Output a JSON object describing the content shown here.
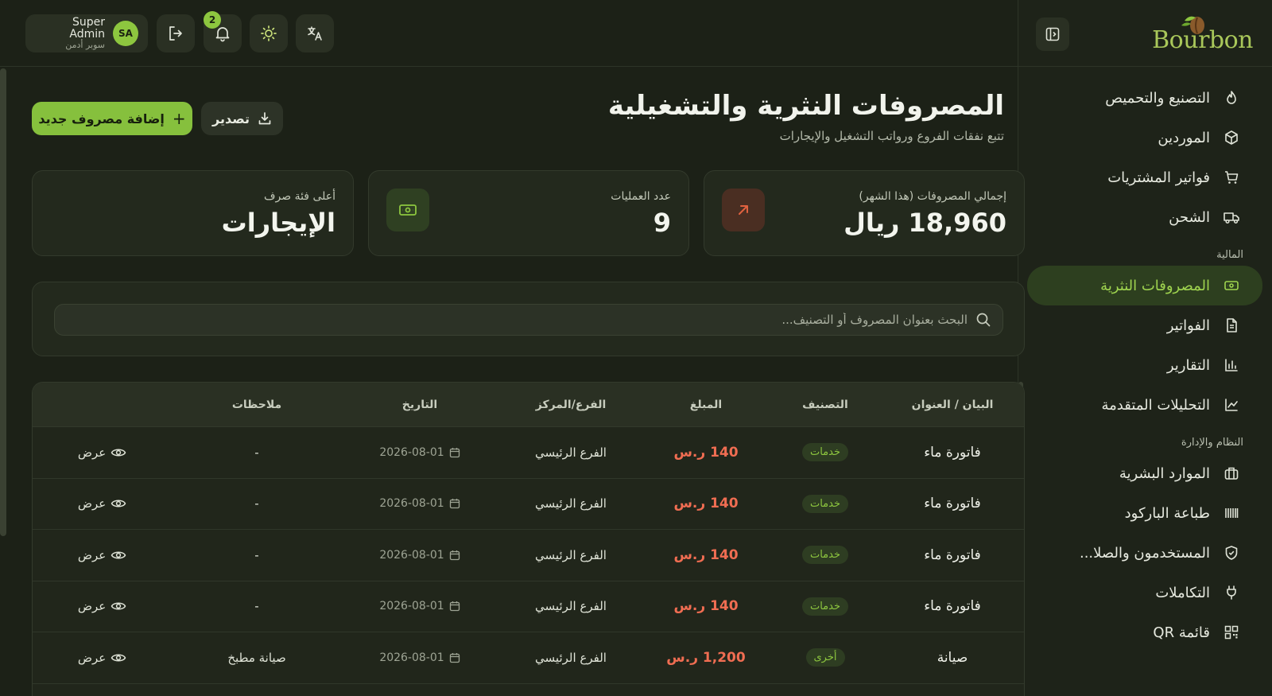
{
  "brand": {
    "name": "Bourbon",
    "accent": "#86c03d"
  },
  "topbar": {
    "user": {
      "name_en": "Super Admin",
      "name_ar": "سوبر أدمن",
      "initials": "SA"
    },
    "notifications_count": "2"
  },
  "sidebar": {
    "items_top": [
      {
        "label": "التصنيع والتحميص",
        "icon": "flame-icon"
      },
      {
        "label": "الموردين",
        "icon": "package-icon"
      },
      {
        "label": "فواتير المشتريات",
        "icon": "cart-icon"
      },
      {
        "label": "الشحن",
        "icon": "truck-icon"
      }
    ],
    "section_finance": "المالية",
    "items_finance": [
      {
        "label": "المصروفات النثرية",
        "icon": "banknote-icon",
        "active": true
      },
      {
        "label": "الفواتير",
        "icon": "file-icon"
      },
      {
        "label": "التقارير",
        "icon": "bar-chart-icon"
      },
      {
        "label": "التحليلات المتقدمة",
        "icon": "line-chart-icon"
      }
    ],
    "section_system": "النظام والإدارة",
    "items_system": [
      {
        "label": "الموارد البشرية",
        "icon": "briefcase-icon"
      },
      {
        "label": "طباعة الباركود",
        "icon": "barcode-icon"
      },
      {
        "label": "المستخدمون والصلا...",
        "icon": "shield-icon"
      },
      {
        "label": "التكاملات",
        "icon": "plug-icon"
      },
      {
        "label": "قائمة QR",
        "icon": "qr-icon"
      }
    ]
  },
  "page": {
    "title": "المصروفات النثرية والتشغيلية",
    "subtitle": "تتبع نفقات الفروع ورواتب التشغيل والإيجارات",
    "add_button": "إضافة مصروف جديد",
    "export_button": "تصدير"
  },
  "stats": [
    {
      "label": "إجمالي المصروفات (هذا الشهر)",
      "value": "18,960 ريال",
      "icon": "arrow-up-right-icon",
      "color": "#e0613f"
    },
    {
      "label": "عدد العمليات",
      "value": "9",
      "icon": "banknote-icon",
      "color": "#8dc63f"
    },
    {
      "label": "أعلى فئة صرف",
      "value": "الإيجارات"
    }
  ],
  "search": {
    "placeholder": "البحث بعنوان المصروف أو التصنيف..."
  },
  "table": {
    "headers": [
      "البيان / العنوان",
      "التصنيف",
      "المبلغ",
      "الفرع/المركز",
      "التاريخ",
      "ملاحظات"
    ],
    "view_label": "عرض",
    "rows": [
      {
        "title": "فاتورة ماء",
        "category": "خدمات",
        "amount": "140 ر.س",
        "branch": "الفرع الرئيسي",
        "date": "2026-08-01",
        "note": "-"
      },
      {
        "title": "فاتورة ماء",
        "category": "خدمات",
        "amount": "140 ر.س",
        "branch": "الفرع الرئيسي",
        "date": "2026-08-01",
        "note": "-"
      },
      {
        "title": "فاتورة ماء",
        "category": "خدمات",
        "amount": "140 ر.س",
        "branch": "الفرع الرئيسي",
        "date": "2026-08-01",
        "note": "-"
      },
      {
        "title": "فاتورة ماء",
        "category": "خدمات",
        "amount": "140 ر.س",
        "branch": "الفرع الرئيسي",
        "date": "2026-08-01",
        "note": "-"
      },
      {
        "title": "صيانة",
        "category": "أخرى",
        "amount": "1,200 ر.س",
        "branch": "الفرع الرئيسي",
        "date": "2026-08-01",
        "note": "صيانة مطبخ"
      }
    ]
  }
}
